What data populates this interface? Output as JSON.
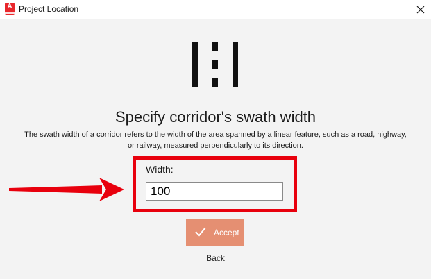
{
  "window": {
    "title": "Project Location",
    "app_icon_letter": "A",
    "close_glyph": "×"
  },
  "main": {
    "heading": "Specify corridor's swath width",
    "description": "The swath width of a corridor refers to the width of the area spanned by a linear feature, such as a road, highway, or railway, measured perpendicularly to its direction.",
    "width_label": "Width:",
    "width_value": "100",
    "accept_label": "Accept",
    "back_label": "Back"
  },
  "colors": {
    "accent_button": "#e58f72",
    "highlight": "#e8000d",
    "app_icon": "#e8262b"
  },
  "icons": {
    "header": "road-swath-icon",
    "accept": "checkmark-icon",
    "annotation": "arrow-right-icon"
  }
}
